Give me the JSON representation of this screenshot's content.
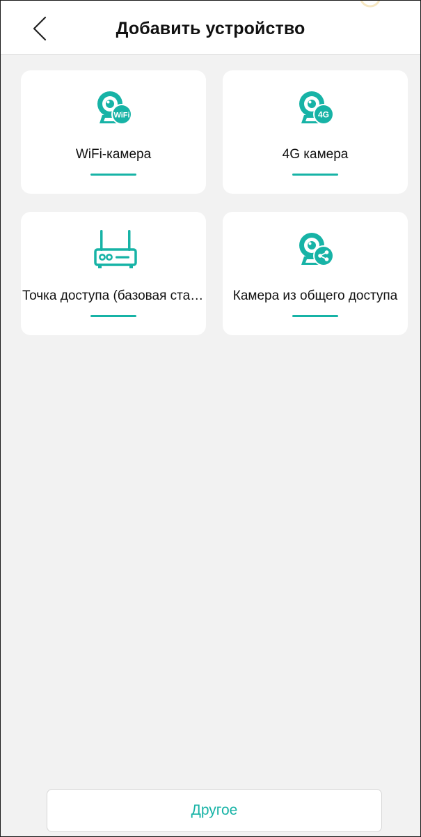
{
  "header": {
    "title": "Добавить устройство",
    "back_icon": "chevron-left-icon"
  },
  "devices": [
    {
      "label": "WiFi-камера",
      "icon": "wifi-camera-icon",
      "badge": "WiFi"
    },
    {
      "label": "4G камера",
      "icon": "4g-camera-icon",
      "badge": "4G"
    },
    {
      "label": "Точка доступа (базовая станция)",
      "icon": "router-icon"
    },
    {
      "label": "Камера из общего доступа",
      "icon": "shared-camera-icon"
    }
  ],
  "footer": {
    "other_label": "Другое"
  },
  "colors": {
    "accent": "#17b3a6",
    "background": "#f2f2f2",
    "card": "#ffffff"
  }
}
